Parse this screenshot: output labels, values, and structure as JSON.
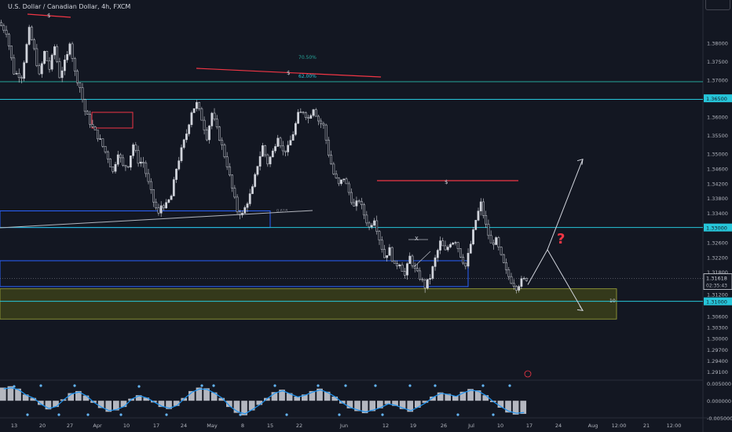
{
  "header": {
    "title": "U.S. Dollar / Canadian Dollar, 4h, FXCM"
  },
  "colors": {
    "background": "#131722",
    "candle": "#d1d4dc",
    "teal": "#26c6da",
    "blue": "#2962ff",
    "red": "#f23645",
    "olive": "#5d6314",
    "axis_text": "#b2b5be"
  },
  "chart_data": [
    {
      "type": "candlestick",
      "title": "U.S. Dollar / Canadian Dollar, 4h, FXCM",
      "ylim": [
        1.2895,
        1.3895
      ],
      "y_ticks": [
        "1.38000",
        "1.37500",
        "1.37000",
        "1.36500",
        "1.36000",
        "1.35500",
        "1.35000",
        "1.34600",
        "1.34200",
        "1.33800",
        "1.33400",
        "1.33000",
        "1.32600",
        "1.32200",
        "1.31800",
        "1.31200",
        "1.30600",
        "1.30300",
        "1.30000",
        "1.29700",
        "1.29400",
        "1.29100"
      ],
      "y_tick_values": [
        1.38,
        1.375,
        1.37,
        1.365,
        1.36,
        1.355,
        1.35,
        1.346,
        1.342,
        1.338,
        1.334,
        1.33,
        1.326,
        1.322,
        1.318,
        1.312,
        1.306,
        1.303,
        1.3,
        1.297,
        1.294,
        1.291
      ],
      "x_ticks": [
        "13",
        "20",
        "27",
        "Apr",
        "10",
        "17",
        "24",
        "May",
        "8",
        "15",
        "22",
        "Jun",
        "12",
        "19",
        "26",
        "Jul",
        "10",
        "17",
        "24",
        "Aug",
        "12:00",
        "21",
        "12:00"
      ],
      "price_path": [
        [
          0,
          1.3855
        ],
        [
          3,
          1.383
        ],
        [
          6,
          1.372
        ],
        [
          9,
          1.371
        ],
        [
          12,
          1.3835
        ],
        [
          14,
          1.378
        ],
        [
          16,
          1.371
        ],
        [
          18,
          1.3775
        ],
        [
          20,
          1.373
        ],
        [
          22,
          1.379
        ],
        [
          24,
          1.371
        ],
        [
          27,
          1.3765
        ],
        [
          28,
          1.3805
        ],
        [
          30,
          1.372
        ],
        [
          32,
          1.368
        ],
        [
          34,
          1.3615
        ],
        [
          37,
          1.357
        ],
        [
          40,
          1.3535
        ],
        [
          43,
          1.349
        ],
        [
          45,
          1.345
        ],
        [
          47,
          1.3505
        ],
        [
          49,
          1.3465
        ],
        [
          51,
          1.347
        ],
        [
          53,
          1.3525
        ],
        [
          55,
          1.348
        ],
        [
          57,
          1.3475
        ],
        [
          59,
          1.342
        ],
        [
          61,
          1.337
        ],
        [
          63,
          1.3335
        ],
        [
          64,
          1.336
        ],
        [
          66,
          1.336
        ],
        [
          68,
          1.3385
        ],
        [
          70,
          1.346
        ],
        [
          72,
          1.351
        ],
        [
          74,
          1.3555
        ],
        [
          76,
          1.3615
        ],
        [
          78,
          1.3635
        ],
        [
          80,
          1.3595
        ],
        [
          82,
          1.3545
        ],
        [
          84,
          1.361
        ],
        [
          86,
          1.3565
        ],
        [
          88,
          1.352
        ],
        [
          90,
          1.347
        ],
        [
          92,
          1.3405
        ],
        [
          94,
          1.3345
        ],
        [
          96,
          1.3335
        ],
        [
          98,
          1.337
        ],
        [
          100,
          1.3405
        ],
        [
          102,
          1.347
        ],
        [
          104,
          1.352
        ],
        [
          106,
          1.3475
        ],
        [
          108,
          1.3505
        ],
        [
          110,
          1.355
        ],
        [
          112,
          1.3505
        ],
        [
          114,
          1.3515
        ],
        [
          116,
          1.3555
        ],
        [
          118,
          1.3605
        ],
        [
          120,
          1.3615
        ],
        [
          122,
          1.3595
        ],
        [
          124,
          1.3625
        ],
        [
          126,
          1.359
        ],
        [
          128,
          1.3575
        ],
        [
          130,
          1.35
        ],
        [
          132,
          1.3445
        ],
        [
          134,
          1.3415
        ],
        [
          136,
          1.3435
        ],
        [
          138,
          1.3395
        ],
        [
          140,
          1.3355
        ],
        [
          142,
          1.3375
        ],
        [
          144,
          1.3335
        ],
        [
          146,
          1.33
        ],
        [
          148,
          1.3325
        ],
        [
          150,
          1.327
        ],
        [
          152,
          1.322
        ],
        [
          154,
          1.324
        ],
        [
          156,
          1.3195
        ],
        [
          158,
          1.3205
        ],
        [
          160,
          1.317
        ],
        [
          162,
          1.322
        ],
        [
          164,
          1.3185
        ],
        [
          166,
          1.3165
        ],
        [
          168,
          1.314
        ],
        [
          170,
          1.3165
        ],
        [
          172,
          1.3215
        ],
        [
          174,
          1.326
        ],
        [
          176,
          1.3235
        ],
        [
          178,
          1.326
        ],
        [
          180,
          1.3265
        ],
        [
          182,
          1.3225
        ],
        [
          184,
          1.3195
        ],
        [
          186,
          1.3255
        ],
        [
          188,
          1.332
        ],
        [
          190,
          1.3365
        ],
        [
          192,
          1.3305
        ],
        [
          194,
          1.3255
        ],
        [
          196,
          1.3265
        ],
        [
          198,
          1.322
        ],
        [
          200,
          1.318
        ],
        [
          202,
          1.3155
        ],
        [
          204,
          1.3138
        ],
        [
          206,
          1.3155
        ],
        [
          208,
          1.31618
        ]
      ],
      "last_price": "1.31618",
      "countdown": "02:35:43",
      "price_labels": [
        {
          "text": "1.36500",
          "value": 1.365
        },
        {
          "text": "1.33000",
          "value": 1.33
        },
        {
          "text": "1.31000",
          "value": 1.31
        }
      ],
      "horizontal_lines": [
        {
          "value": 1.3695,
          "color": "#26a69a"
        },
        {
          "value": 1.3647,
          "color": "#26c6da"
        },
        {
          "value": 1.33,
          "color": "#26c6da"
        },
        {
          "value": 1.31,
          "color": "#26c6da"
        }
      ],
      "annotations": [
        "$",
        "$",
        "$",
        "70.50%",
        "62.00%",
        "X",
        "0.618",
        "10",
        "?"
      ],
      "zones": [
        {
          "type": "demand",
          "color": "#5d6314",
          "from": 1.3052,
          "to": 1.3134
        },
        {
          "type": "box",
          "color": "#2962ff",
          "from": 1.33,
          "to": 1.3345
        },
        {
          "type": "box",
          "color": "#2962ff",
          "from": 1.314,
          "to": 1.321
        }
      ],
      "projection": {
        "up_target": 1.3485,
        "down_target": 1.3075,
        "pivot": 1.324
      }
    },
    {
      "type": "bar",
      "title": "oscillator",
      "ylim": [
        -0.0045,
        0.0055
      ],
      "y_ticks": [
        "0.005000",
        "0.000000",
        "-0.005000"
      ],
      "y_tick_values": [
        0.005,
        0.0,
        -0.005
      ],
      "values": [
        0.0038,
        0.0042,
        0.0035,
        0.0018,
        0.0008,
        -0.0012,
        -0.0025,
        -0.0018,
        0.0004,
        0.0022,
        0.0028,
        0.0015,
        -0.0006,
        -0.0021,
        -0.0032,
        -0.0028,
        -0.0018,
        0.0006,
        0.0016,
        0.0009,
        -0.0005,
        -0.0018,
        -0.0024,
        -0.0015,
        0.0008,
        0.0028,
        0.0038,
        0.0036,
        0.0024,
        0.0008,
        -0.0018,
        -0.0035,
        -0.0042,
        -0.0028,
        -0.0012,
        0.0008,
        0.0025,
        0.0032,
        0.0022,
        0.0012,
        0.0018,
        0.0028,
        0.0035,
        0.0026,
        0.0012,
        -0.0008,
        -0.0022,
        -0.003,
        -0.0036,
        -0.003,
        -0.0022,
        -0.001,
        -0.0015,
        -0.0024,
        -0.0032,
        -0.002,
        -0.0006,
        0.0012,
        0.0024,
        0.002,
        0.0014,
        0.0026,
        0.0034,
        0.003,
        0.0016,
        -0.0004,
        -0.002,
        -0.0034,
        -0.004,
        -0.0038
      ]
    }
  ]
}
